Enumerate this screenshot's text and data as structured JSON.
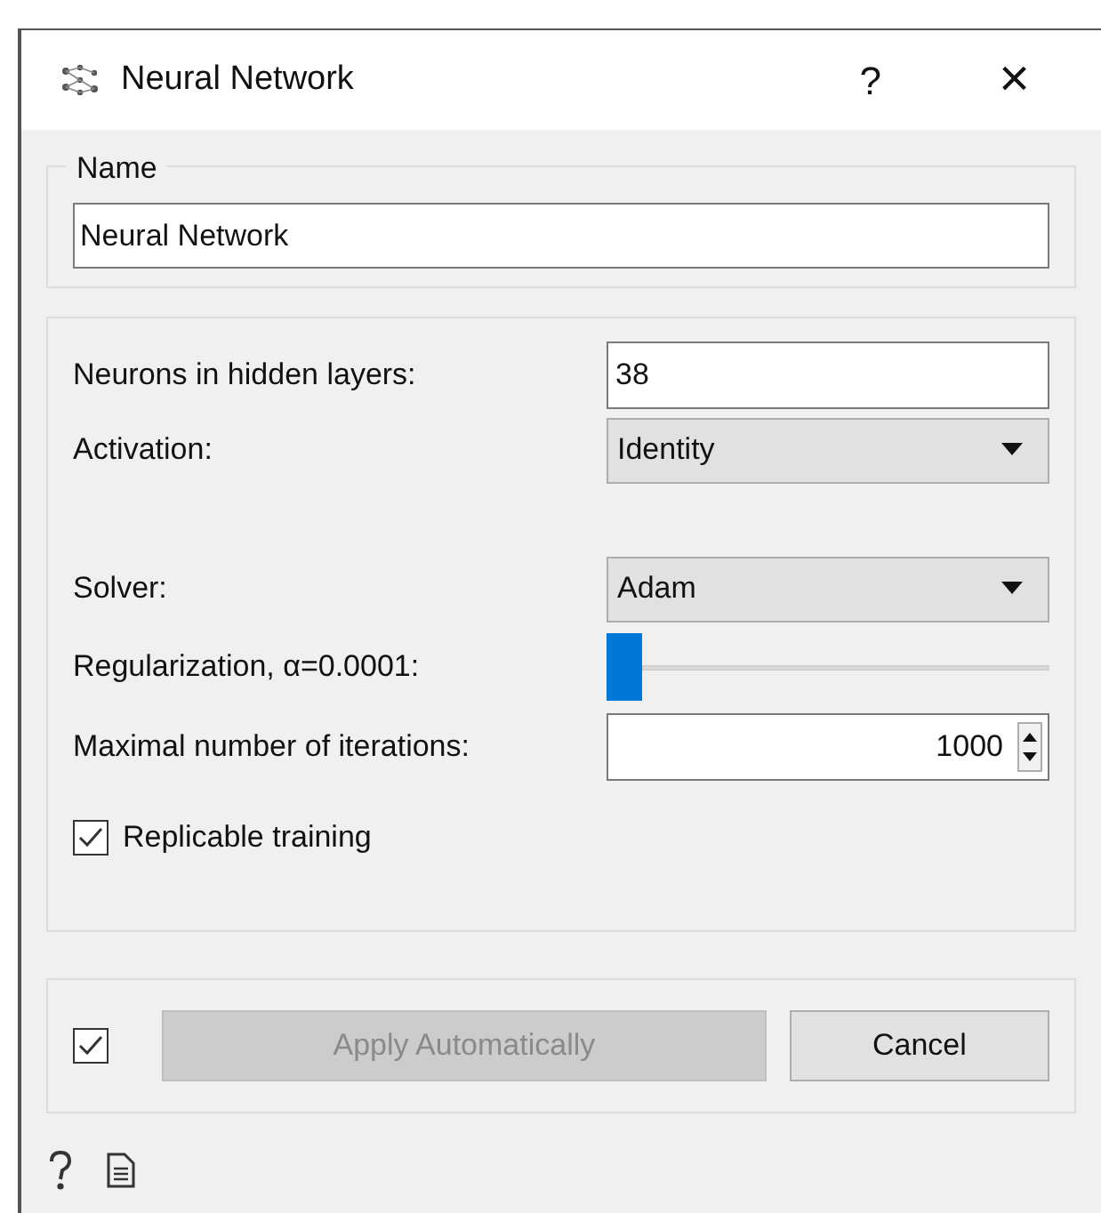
{
  "window": {
    "title": "Neural Network",
    "help": "?",
    "close": "×"
  },
  "name_group": {
    "title": "Name",
    "value": "Neural Network"
  },
  "params": [
    {
      "kind": "text",
      "label": "Neurons in hidden layers:",
      "value": "38"
    },
    {
      "kind": "select",
      "label": "Activation:",
      "value": "Identity"
    },
    {
      "kind": "gap"
    },
    {
      "kind": "select",
      "label": "Solver:",
      "value": "Adam"
    },
    {
      "kind": "slider",
      "label": "Regularization, α=0.0001:",
      "level": 0
    },
    {
      "kind": "spin",
      "label": "Maximal number of iterations:",
      "value": "1000"
    }
  ],
  "replicable": {
    "label": "Replicable training",
    "checked": true
  },
  "footer": {
    "auto_checked": true,
    "apply": {
      "label": "Apply Automatically",
      "disabled": true
    },
    "cancel": "Cancel"
  }
}
